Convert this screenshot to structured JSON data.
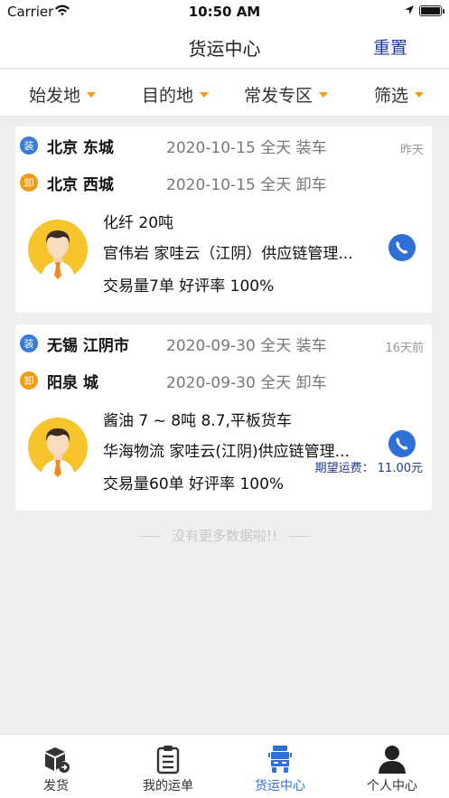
{
  "status_bar": {
    "carrier": "Carrier",
    "time": "10:50 AM"
  },
  "nav": {
    "title": "货运中心",
    "reset": "重置"
  },
  "filters": [
    {
      "label": "始发地"
    },
    {
      "label": "目的地"
    },
    {
      "label": "常发专区"
    },
    {
      "label": "筛选"
    }
  ],
  "orders": [
    {
      "load_tag": "装",
      "unload_tag": "卸",
      "origin": "北京 东城",
      "load_info": "2020-10-15 全天 装车",
      "destination": "北京 西城",
      "unload_info": "2020-10-15 全天 卸车",
      "time_ago": "昨天",
      "cargo": "化纤  20吨",
      "company": "官伟岩 家哇云（江阴）供应链管理...",
      "stats": "交易量7单 好评率 100%",
      "freight": ""
    },
    {
      "load_tag": "装",
      "unload_tag": "卸",
      "origin": "无锡 江阴市",
      "load_info": "2020-09-30 全天 装车",
      "destination": "阳泉 城",
      "unload_info": "2020-09-30 全天 卸车",
      "time_ago": "16天前",
      "cargo": "酱油 7 ~ 8吨 8.7,平板货车",
      "company": "华海物流   家哇云(江阴)供应链管理...",
      "stats": "交易量60单 好评率 100%",
      "freight": "期望运费：  11.00元"
    }
  ],
  "no_more": "没有更多数据啦!!",
  "tabs": [
    {
      "label": "发货",
      "icon": "package-icon",
      "active": false
    },
    {
      "label": "我的运单",
      "icon": "clipboard-icon",
      "active": false
    },
    {
      "label": "货运中心",
      "icon": "truck-icon",
      "active": true
    },
    {
      "label": "个人中心",
      "icon": "person-icon",
      "active": false
    }
  ],
  "colors": {
    "accent": "#2f6fd8",
    "caret": "#f39c12",
    "reset": "#1f3a93",
    "avatar_bg": "#f7c52b"
  }
}
